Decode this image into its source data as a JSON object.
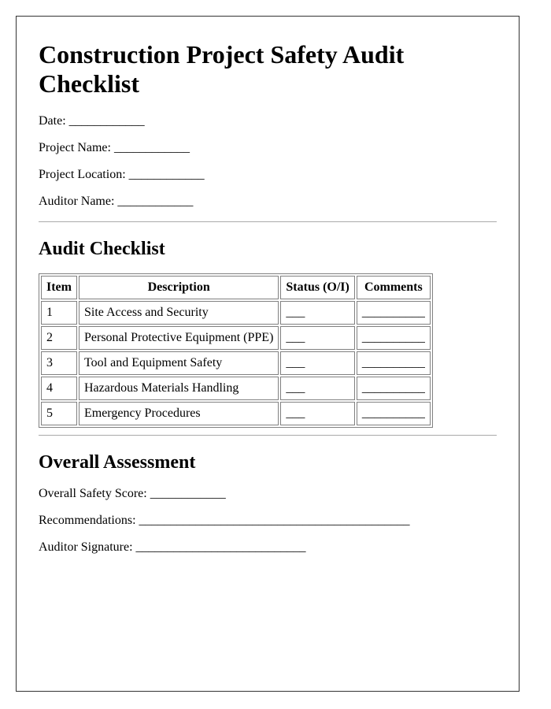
{
  "title": "Construction Project Safety Audit Checklist",
  "header_fields": [
    {
      "label": "Date:",
      "value": "____________"
    },
    {
      "label": "Project Name:",
      "value": "____________"
    },
    {
      "label": "Project Location:",
      "value": "____________"
    },
    {
      "label": "Auditor Name:",
      "value": "____________"
    }
  ],
  "checklist": {
    "heading": "Audit Checklist",
    "columns": [
      "Item",
      "Description",
      "Status (O/I)",
      "Comments"
    ],
    "rows": [
      {
        "item": "1",
        "description": "Site Access and Security",
        "status": "___",
        "comments": "__________"
      },
      {
        "item": "2",
        "description": "Personal Protective Equipment (PPE)",
        "status": "___",
        "comments": "__________"
      },
      {
        "item": "3",
        "description": "Tool and Equipment Safety",
        "status": "___",
        "comments": "__________"
      },
      {
        "item": "4",
        "description": "Hazardous Materials Handling",
        "status": "___",
        "comments": "__________"
      },
      {
        "item": "5",
        "description": "Emergency Procedures",
        "status": "___",
        "comments": "__________"
      }
    ]
  },
  "assessment": {
    "heading": "Overall Assessment",
    "fields": [
      {
        "label": "Overall Safety Score:",
        "value": "____________"
      },
      {
        "label": "Recommendations:",
        "value": "___________________________________________"
      },
      {
        "label": "Auditor Signature:",
        "value": "___________________________"
      }
    ]
  }
}
